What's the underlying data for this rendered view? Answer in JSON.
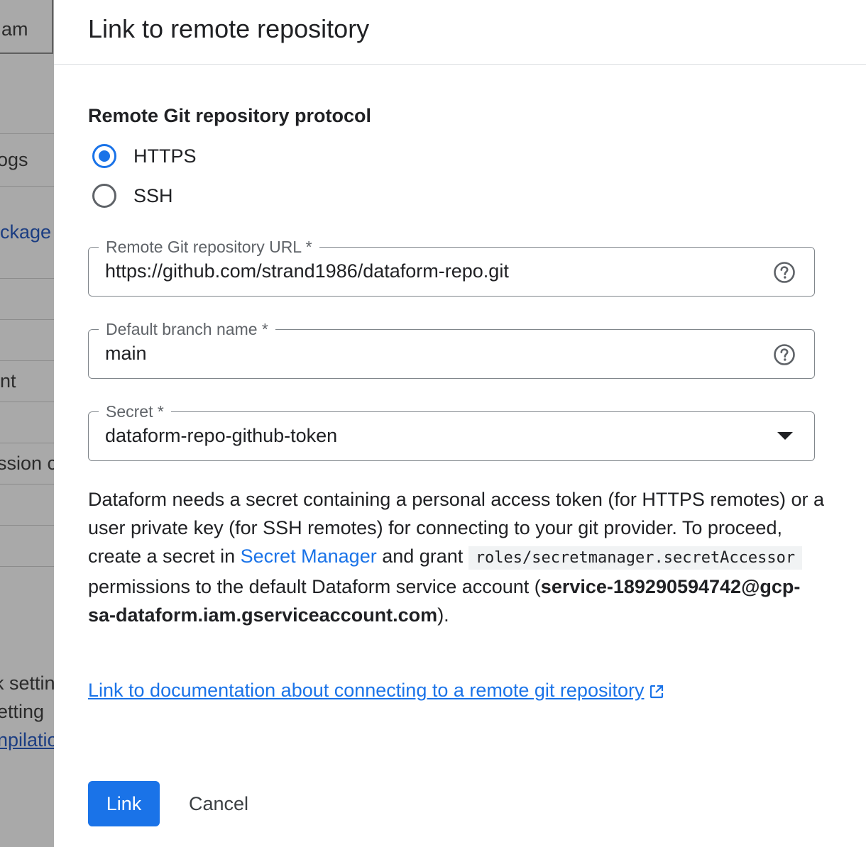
{
  "background": {
    "items": [
      {
        "text": "am",
        "style": "normal"
      },
      {
        "text": "ogs",
        "style": "normal"
      },
      {
        "text": "ckage",
        "style": "link"
      },
      {
        "text": "nt",
        "style": "normal"
      },
      {
        "text": "ssion c",
        "style": "normal"
      },
      {
        "text": "k settin",
        "style": "normal"
      },
      {
        "text": "etting",
        "style": "normal"
      },
      {
        "text": "npilatio",
        "style": "link"
      }
    ]
  },
  "dialog": {
    "title": "Link to remote repository",
    "protocol": {
      "label": "Remote Git repository protocol",
      "options": [
        {
          "label": "HTTPS",
          "checked": true
        },
        {
          "label": "SSH",
          "checked": false
        }
      ]
    },
    "url_field": {
      "label": "Remote Git repository URL *",
      "value": "https://github.com/strand1986/dataform-repo.git",
      "icon": "help-icon"
    },
    "branch_field": {
      "label": "Default branch name *",
      "value": "main",
      "icon": "help-icon"
    },
    "secret_field": {
      "label": "Secret *",
      "value": "dataform-repo-github-token",
      "icon": "dropdown-arrow-icon"
    },
    "description": {
      "part1": "Dataform needs a secret containing a personal access token (for HTTPS remotes) or a user private key (for SSH remotes) for connecting to your git provider. To proceed, create a secret in ",
      "link": "Secret Manager",
      "part2": " and grant ",
      "code": "roles/secretmanager.secretAccessor",
      "part3": " permissions to the default Dataform service account (",
      "account": "service-189290594742@gcp-sa-dataform.iam.gserviceaccount.com",
      "part4": ")."
    },
    "doc_link": "Link to documentation about connecting to a remote git repository",
    "buttons": {
      "primary": "Link",
      "cancel": "Cancel"
    },
    "colors": {
      "accent": "#1a73e8",
      "text": "#202124",
      "muted": "#5f6368"
    }
  }
}
